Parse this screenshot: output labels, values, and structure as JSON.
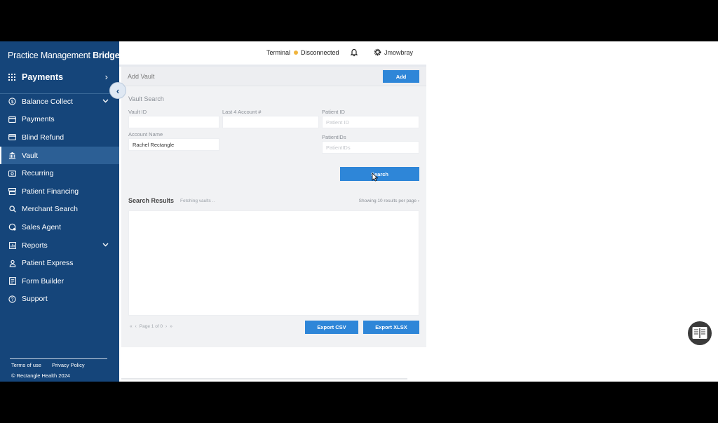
{
  "sidebar": {
    "brand_regular": "Practice Management ",
    "brand_bold": "Bridge",
    "brand_mark": "®",
    "app": {
      "label": "Payments",
      "chevron": "›"
    },
    "collapse_glyph": "‹",
    "items": [
      {
        "label": "Balance Collect",
        "icon": "dollar-circle-icon",
        "expandable": true
      },
      {
        "label": "Payments",
        "icon": "card-icon",
        "expandable": false
      },
      {
        "label": "Blind Refund",
        "icon": "card-icon",
        "expandable": false
      },
      {
        "label": "Vault",
        "icon": "bank-icon",
        "expandable": false,
        "active": true
      },
      {
        "label": "Recurring",
        "icon": "cash-icon",
        "expandable": false
      },
      {
        "label": "Patient Financing",
        "icon": "register-icon",
        "expandable": false
      },
      {
        "label": "Merchant Search",
        "icon": "search-icon",
        "expandable": false
      },
      {
        "label": "Sales Agent",
        "icon": "agent-icon",
        "expandable": false
      },
      {
        "label": "Reports",
        "icon": "report-icon",
        "expandable": true
      },
      {
        "label": "Patient Express",
        "icon": "person-icon",
        "expandable": false
      },
      {
        "label": "Form Builder",
        "icon": "form-icon",
        "expandable": false
      },
      {
        "label": "Support",
        "icon": "help-circle-icon",
        "expandable": false
      }
    ],
    "footer": {
      "terms": "Terms of use",
      "privacy": "Privacy Policy",
      "copyright": "© Rectangle Health 2024"
    }
  },
  "topbar": {
    "terminal_label": "Terminal",
    "terminal_status": "Disconnected",
    "status_color": "#f0b43c",
    "username": "Jmowbray"
  },
  "add_vault": {
    "title": "Add Vault",
    "button": "Add"
  },
  "vault_search": {
    "title": "Vault Search",
    "fields": {
      "vault_id": {
        "label": "Vault ID",
        "value": "",
        "placeholder": ""
      },
      "last4": {
        "label": "Last 4 Account #",
        "value": "",
        "placeholder": ""
      },
      "patient_id": {
        "label": "Patient ID",
        "value": "",
        "placeholder": "Patient ID"
      },
      "account_name": {
        "label": "Account Name",
        "value": "Rachel Rectangle",
        "placeholder": ""
      },
      "patient_ids": {
        "label": "PatientIDs",
        "value": "",
        "placeholder": "PatientIDs"
      }
    },
    "search_button": "Search"
  },
  "results": {
    "title": "Search Results",
    "status": "Fetching vaults ..",
    "per_page": "Showing 10 results per page",
    "pager_text": "Page 1 of 0",
    "export_csv": "Export CSV",
    "export_xlsx": "Export XLSX"
  },
  "colors": {
    "sidebar_bg": "#15457a",
    "sidebar_active": "#2c5f95",
    "accent": "#2e86d8"
  }
}
